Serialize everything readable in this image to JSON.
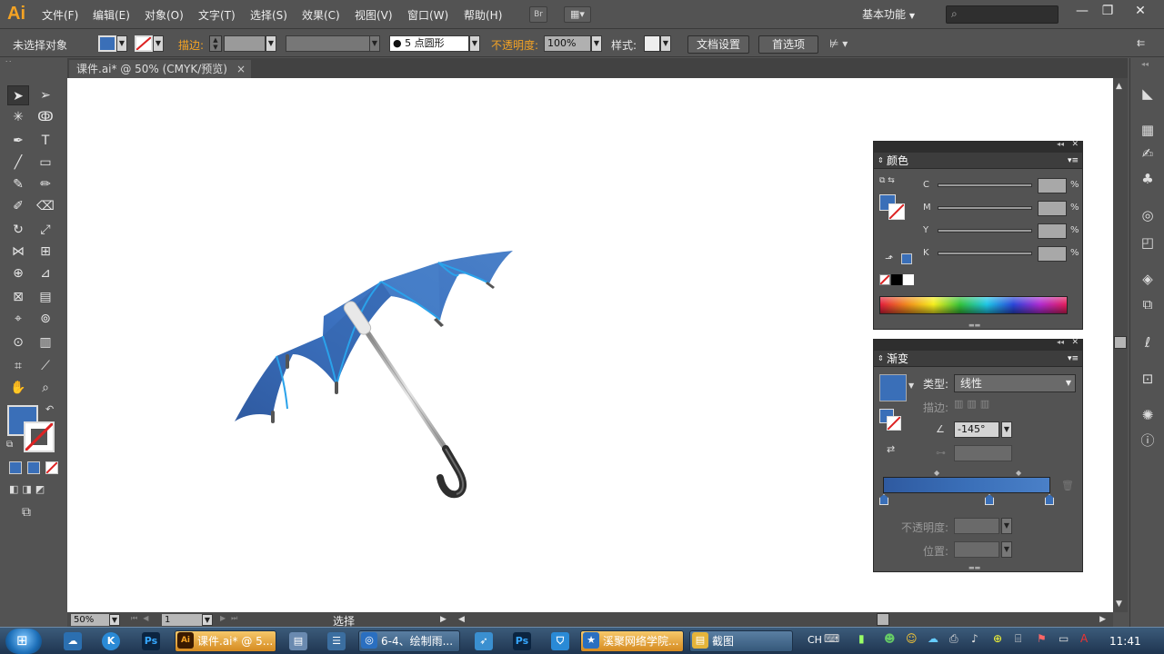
{
  "app": {
    "logo": "Ai"
  },
  "menu": [
    "文件(F)",
    "编辑(E)",
    "对象(O)",
    "文字(T)",
    "选择(S)",
    "效果(C)",
    "视图(V)",
    "窗口(W)",
    "帮助(H)"
  ],
  "bridge_label": "Br",
  "workspace": "基本功能",
  "window_controls": {
    "minimize": "—",
    "restore": "❐",
    "close": "✕"
  },
  "control_bar": {
    "selection": "未选择对象",
    "stroke_label": "描边:",
    "brush_value": "5 点圆形",
    "opacity_label": "不透明度:",
    "opacity_value": "100%",
    "style_label": "样式:",
    "doc_setup": "文档设置",
    "preferences": "首选项"
  },
  "document_tab": {
    "title": "课件.ai* @ 50% (CMYK/预览)",
    "close": "×"
  },
  "status_bar": {
    "zoom": "50%",
    "page": "1",
    "tool_text": "选择"
  },
  "panels": {
    "color": {
      "title": "颜色",
      "channels": [
        "C",
        "M",
        "Y",
        "K"
      ],
      "percent": "%"
    },
    "gradient": {
      "title": "渐变",
      "type_label": "类型:",
      "type_value": "线性",
      "stroke_label": "描边:",
      "angle_value": "-145°",
      "opacity_label": "不透明度:",
      "position_label": "位置:"
    }
  },
  "colors": {
    "fill": "#3a6fb8",
    "umbrella_dark": "#3560a6",
    "umbrella_light": "#4a86d0",
    "rib": "#2fa0e8",
    "accent": "#f4a324"
  },
  "taskbar": {
    "tasks": [
      {
        "label": "课件.ai* @ 5...",
        "icon": "Ai"
      },
      {
        "label": "6-4、绘制雨...",
        "icon": "◎"
      },
      {
        "label": "溪聚网络学院...",
        "icon": "★"
      },
      {
        "label": "截图",
        "icon": "▤"
      }
    ],
    "ime": "CH",
    "clock": "11:41"
  }
}
